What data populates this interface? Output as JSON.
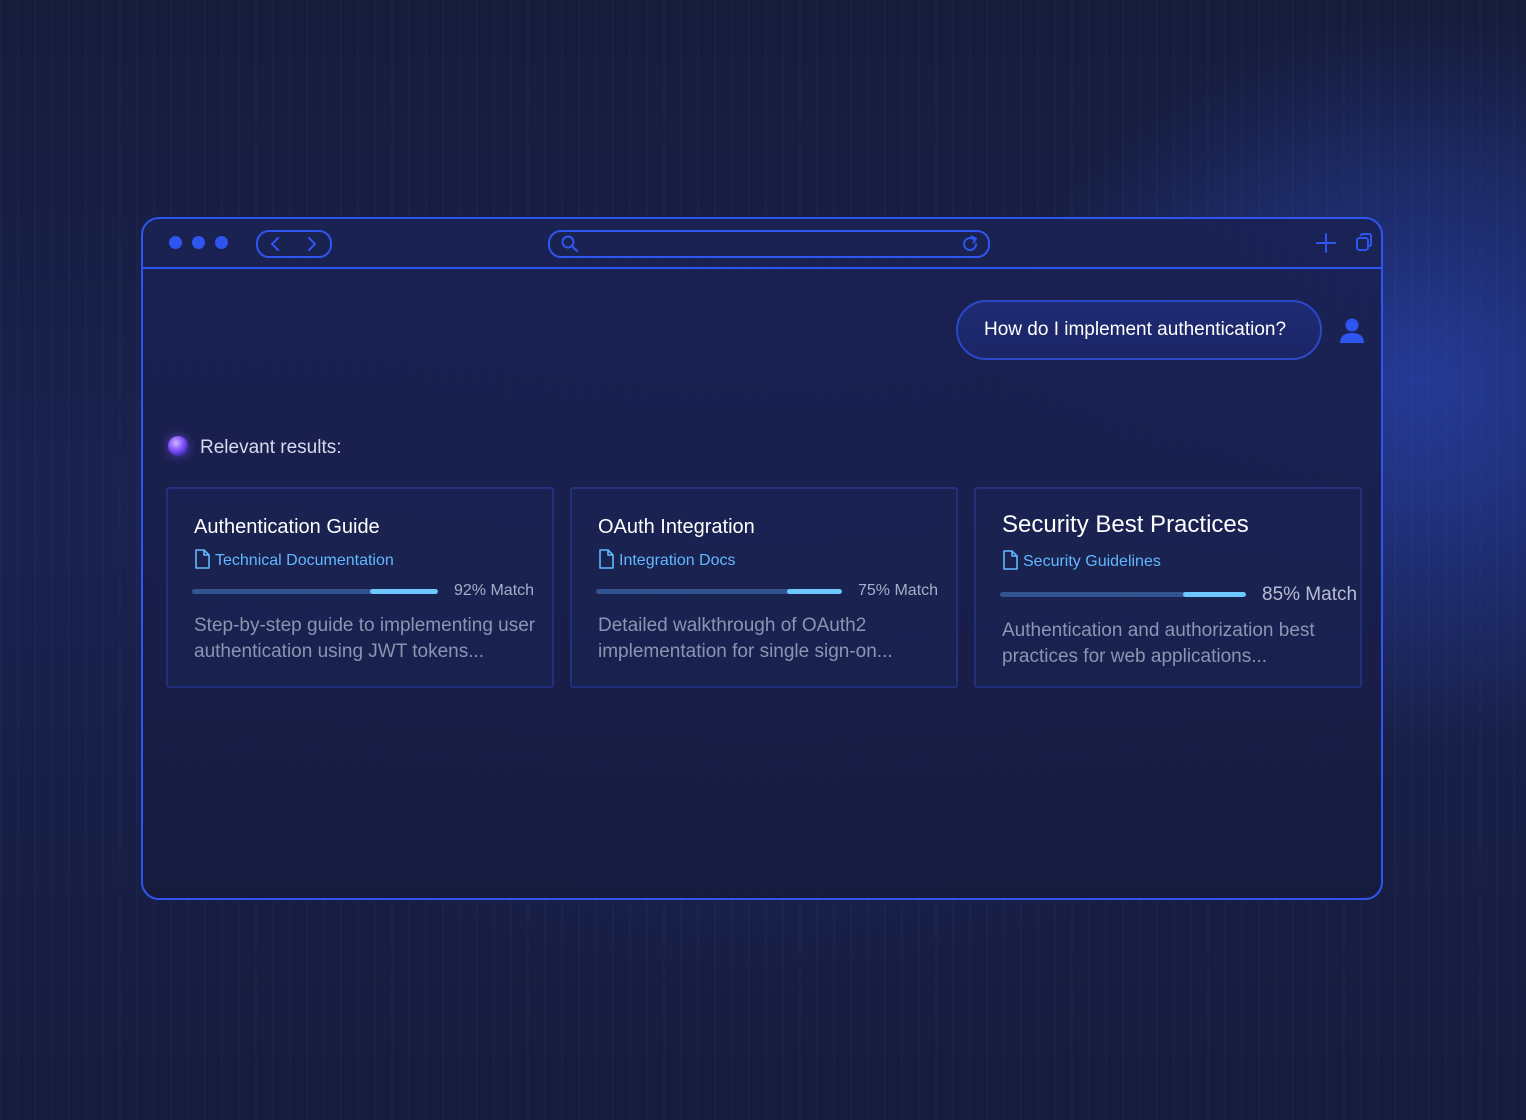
{
  "browser": {
    "url_placeholder": "",
    "icons": {
      "back": "chevron-left-icon",
      "forward": "chevron-right-icon",
      "search": "search-icon",
      "reload": "reload-icon",
      "new_tab": "plus-icon",
      "tabs": "copy-icon"
    }
  },
  "chat": {
    "user_message": "How do I implement authentication?",
    "results_label": "Relevant results:"
  },
  "results": [
    {
      "title": "Authentication Guide",
      "source": "Technical Documentation",
      "match_percent": 92,
      "match_label": "92% Match",
      "description": "Step-by-step guide to implementing user authentication using JWT tokens..."
    },
    {
      "title": "OAuth Integration",
      "source": "Integration Docs",
      "match_percent": 75,
      "match_label": "75% Match",
      "description": "Detailed walkthrough of OAuth2 implementation for single sign-on..."
    },
    {
      "title": "Security Best Practices",
      "source": "Security Guidelines",
      "match_percent": 85,
      "match_label": "85% Match",
      "description": "Authentication and authorization best practices for web applications..."
    }
  ],
  "colors": {
    "accent": "#2f55f0",
    "source_link": "#62b8ff",
    "bar_fill": "#6fc7ff",
    "bar_track": "#33548e"
  }
}
